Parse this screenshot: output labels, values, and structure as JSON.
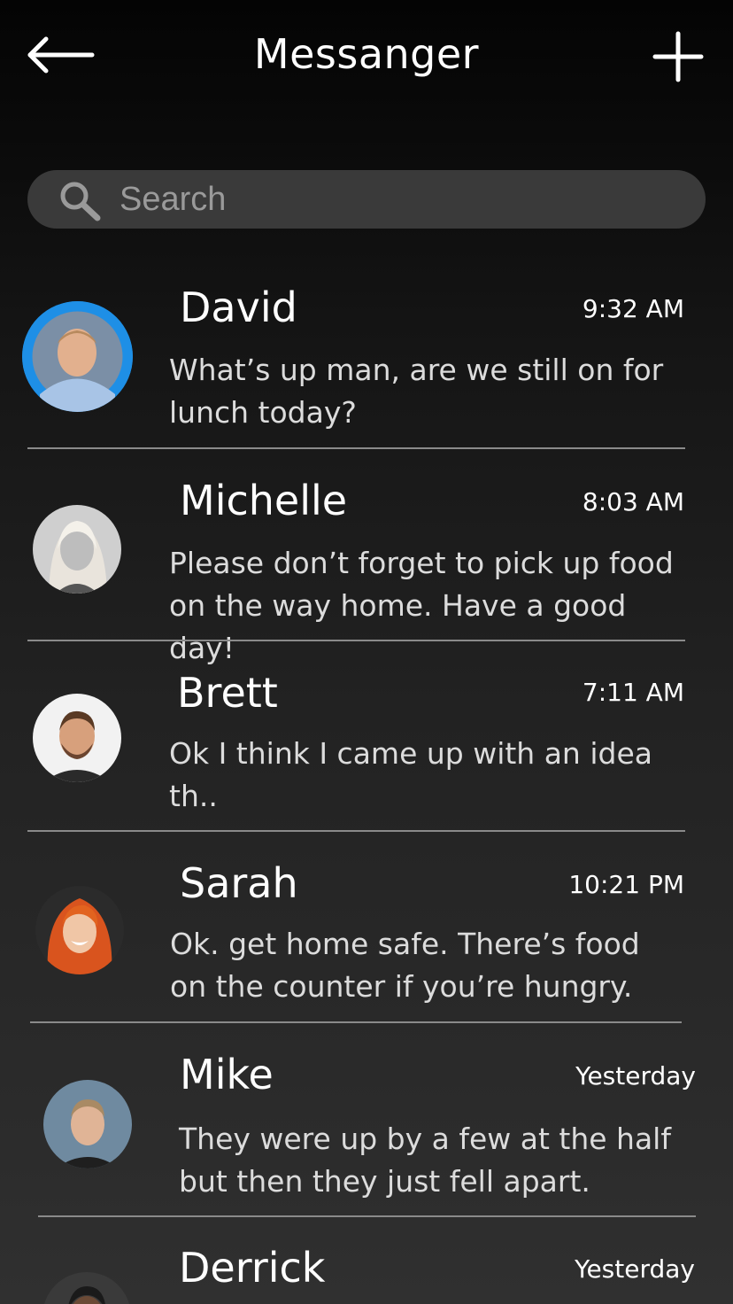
{
  "header": {
    "title": "Messanger"
  },
  "search": {
    "placeholder": "Search",
    "value": ""
  },
  "conversations": [
    {
      "name": "David",
      "time": "9:32 AM",
      "message": "What’s up man, are we still on for lunch today?",
      "active": true
    },
    {
      "name": "Michelle",
      "time": "8:03 AM",
      "message": "Please don’t forget to pick up food on the way home. Have a good day!"
    },
    {
      "name": "Brett",
      "time": "7:11 AM",
      "message": "Ok I think I came up with an idea th.."
    },
    {
      "name": "Sarah",
      "time": "10:21 PM",
      "message": "Ok. get home safe. There’s food on the counter if you’re hungry."
    },
    {
      "name": "Mike",
      "time": "Yesterday",
      "message": "They were up by a few at the half but then they just fell apart."
    },
    {
      "name": "Derrick",
      "time": "Yesterday",
      "message": ""
    }
  ],
  "colors": {
    "active_ring": "#1e8fe6",
    "search_bg": "#3a3a3a",
    "divider": "#8a8a8a"
  }
}
